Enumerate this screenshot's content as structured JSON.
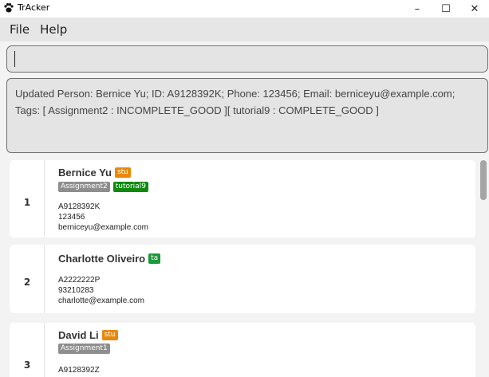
{
  "window": {
    "title": "TrAcker",
    "minimize": "–",
    "maximize": "☐",
    "close": "✕"
  },
  "menu": [
    "File",
    "Help"
  ],
  "command": {
    "value": ""
  },
  "result": {
    "line1": "Updated Person: Bernice Yu; ID: A9128392K; Phone: 123456; Email: berniceyu@example.com;",
    "line2": "Tags: [ Assignment2 : INCOMPLETE_GOOD ][ tutorial9 : COMPLETE_GOOD ]"
  },
  "persons": [
    {
      "index": "1",
      "name": "Bernice Yu",
      "role": "stu",
      "tags": [
        {
          "label": "Assignment2",
          "status": "incomplete"
        },
        {
          "label": "tutorial9",
          "status": "complete"
        }
      ],
      "id": "A9128392K",
      "phone": "123456",
      "email": "berniceyu@example.com"
    },
    {
      "index": "2",
      "name": "Charlotte Oliveiro",
      "role": "ta",
      "tags": [],
      "id": "A2222222P",
      "phone": "93210283",
      "email": "charlotte@example.com"
    },
    {
      "index": "3",
      "name": "David Li",
      "role": "stu",
      "tags": [
        {
          "label": "Assignment1",
          "status": "incomplete"
        }
      ],
      "id": "A9128392Z",
      "phone": "",
      "email": ""
    }
  ],
  "colors": {
    "role_stu": "#e8890d",
    "role_ta": "#1a9a3a",
    "tag_incomplete": "#8e8e8e",
    "tag_complete": "#0f8a0f"
  },
  "icons": {
    "app": "paw-icon"
  }
}
